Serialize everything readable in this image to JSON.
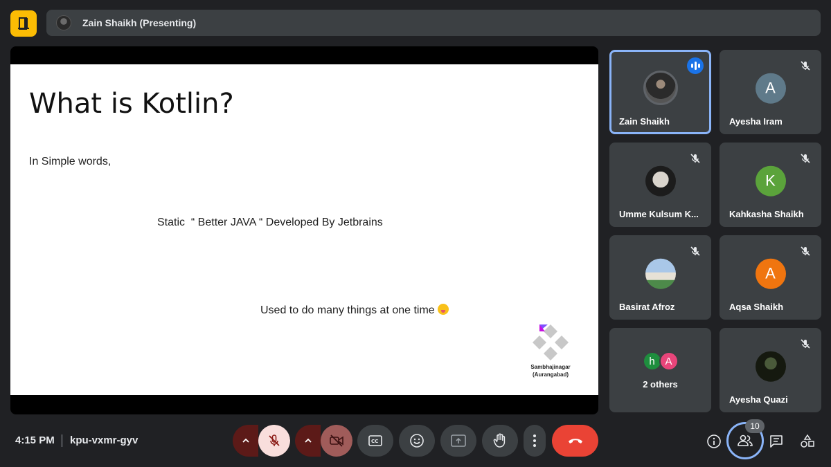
{
  "topbar": {
    "presenter_label": "Zain Shaikh (Presenting)"
  },
  "slide": {
    "title": "What is Kotlin?",
    "line1": "In Simple words,",
    "line2": "Static  “ Better JAVA “ Developed By Jetbrains",
    "line3": "Used to do many things at one time",
    "logo_caption_1": "Sambhajinagar",
    "logo_caption_2": "(Aurangabad)"
  },
  "participants": [
    {
      "name": "Zain Shaikh",
      "initial": "",
      "status": "speaking"
    },
    {
      "name": "Ayesha Iram",
      "initial": "A",
      "color": "#5f7a8a",
      "status": "muted"
    },
    {
      "name": "Umme Kulsum K...",
      "initial": "",
      "status": "muted"
    },
    {
      "name": "Kahkasha Shaikh",
      "initial": "K",
      "color": "#5ba33b",
      "status": "muted"
    },
    {
      "name": "Basirat Afroz",
      "initial": "",
      "status": "muted"
    },
    {
      "name": "Aqsa Shaikh",
      "initial": "A",
      "color": "#f0750f",
      "status": "muted"
    },
    {
      "name": "2 others",
      "initial_1": "h",
      "color_1": "#1e8e3e",
      "initial_2": "A",
      "color_2": "#e8457a"
    },
    {
      "name": "Ayesha Quazi",
      "initial": "",
      "status": "muted"
    }
  ],
  "bottombar": {
    "time": "4:15 PM",
    "meeting_code": "kpu-vxmr-gyv",
    "people_count": "10"
  },
  "colors": {
    "background": "#202124",
    "tile": "#3c4043",
    "accent": "#8ab4f8",
    "leave": "#ea4335",
    "brand_yellow": "#fbbc04"
  }
}
